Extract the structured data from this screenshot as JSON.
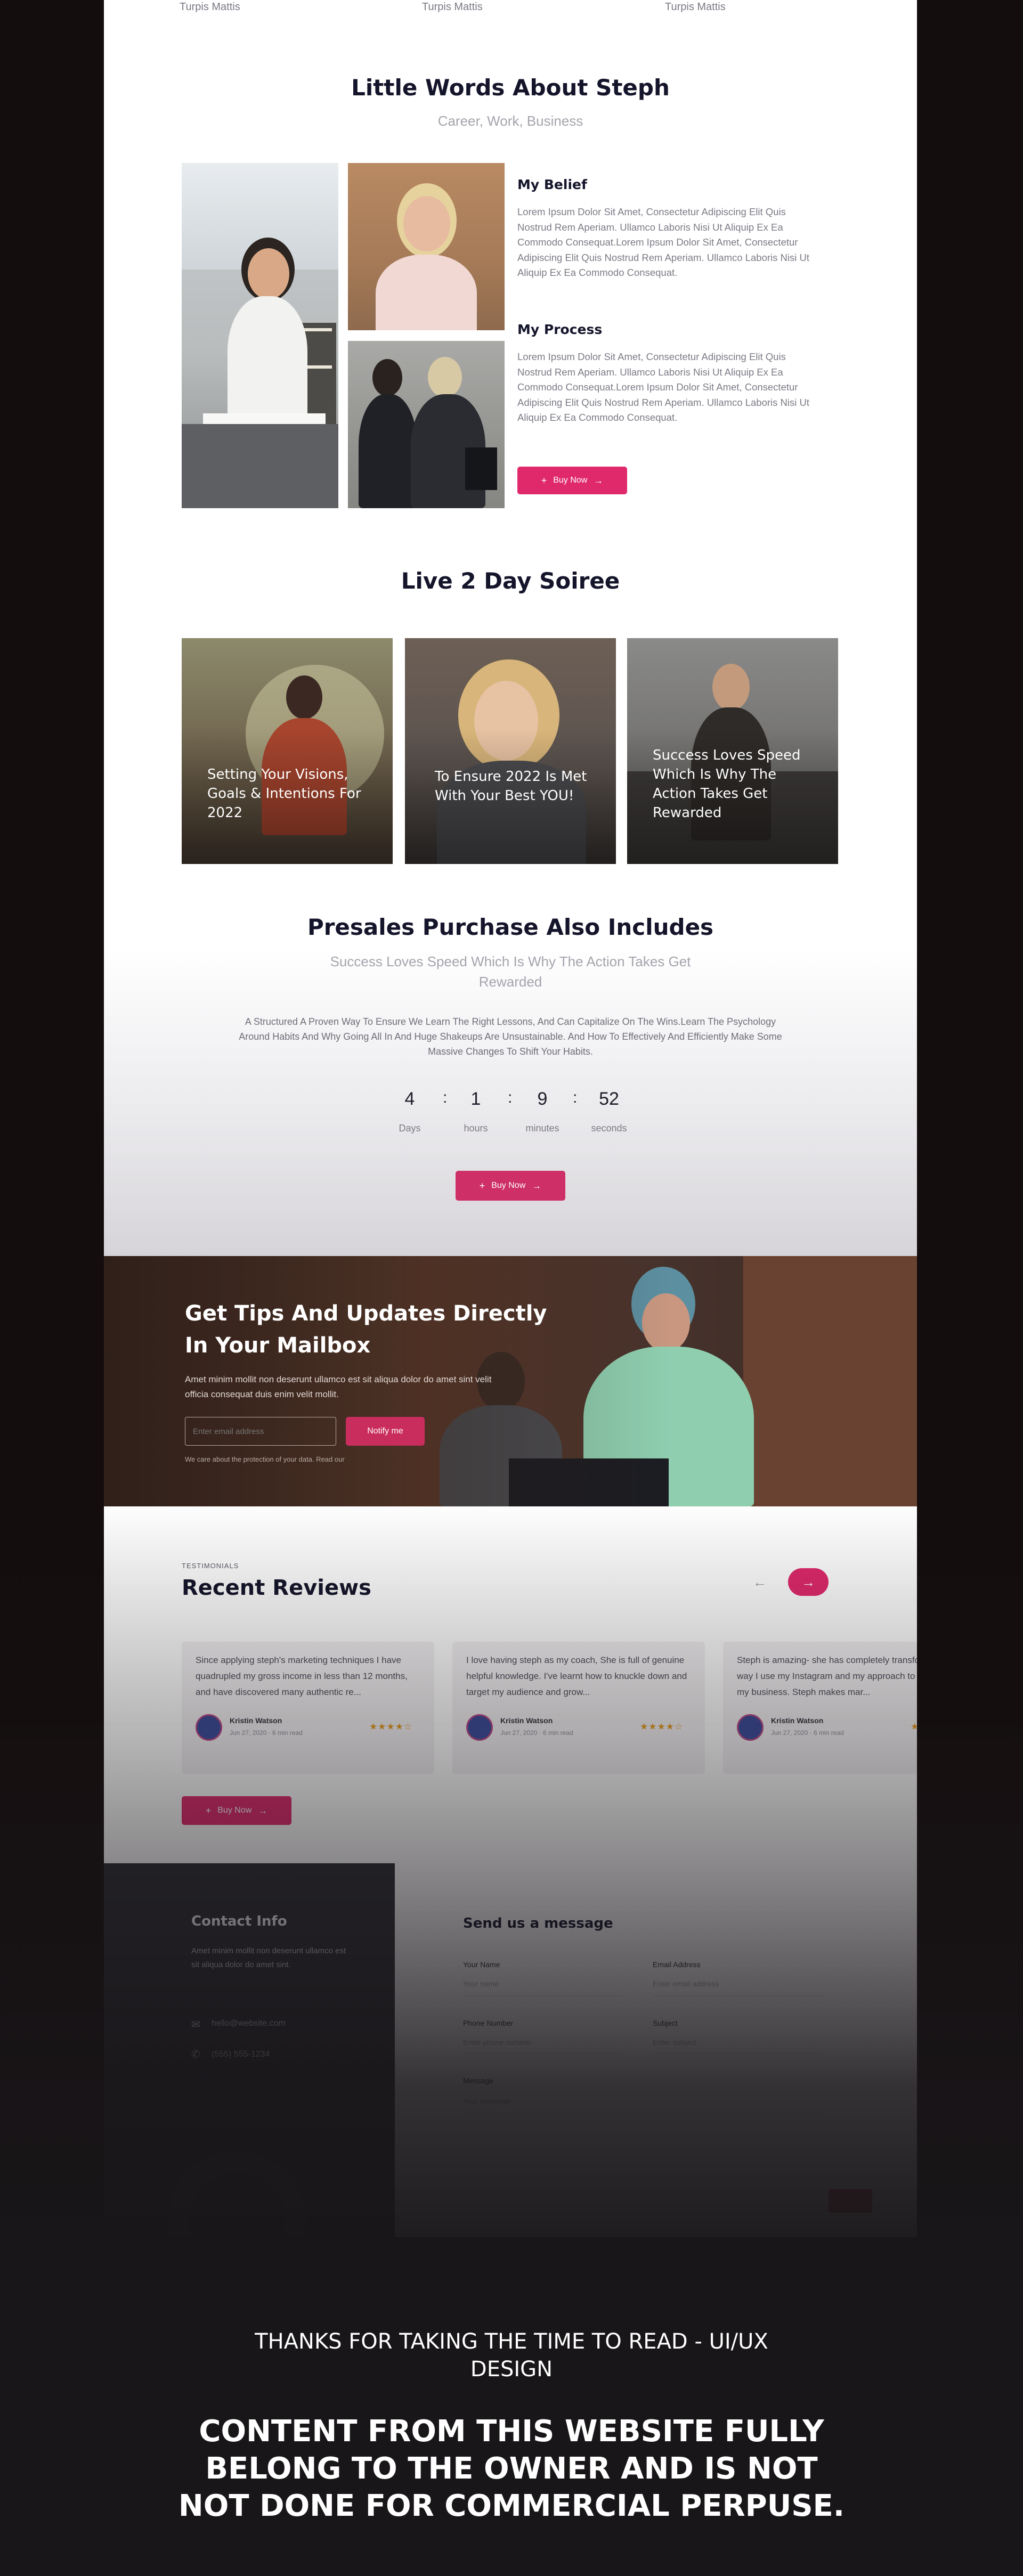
{
  "top_names": [
    "Turpis Mattis",
    "Turpis Mattis",
    "Turpis Mattis"
  ],
  "about": {
    "title": "Little Words About Steph",
    "subtitle": "Career, Work, Business",
    "belief_title": "My Belief",
    "belief_text": "Lorem Ipsum Dolor Sit Amet, Consectetur Adipiscing Elit Quis Nostrud Rem Aperiam. Ullamco Laboris Nisi Ut Aliquip Ex Ea Commodo Consequat.Lorem Ipsum Dolor Sit Amet, Consectetur Adipiscing Elit Quis Nostrud Rem Aperiam. Ullamco Laboris Nisi Ut Aliquip Ex Ea Commodo Consequat.",
    "process_title": "My Process",
    "process_text": "Lorem Ipsum Dolor Sit Amet, Consectetur Adipiscing Elit Quis Nostrud Rem Aperiam. Ullamco Laboris Nisi Ut Aliquip Ex Ea Commodo Consequat.Lorem Ipsum Dolor Sit Amet, Consectetur Adipiscing Elit Quis Nostrud Rem Aperiam. Ullamco Laboris Nisi Ut Aliquip Ex Ea Commodo Consequat.",
    "button": "Buy Now"
  },
  "soiree": {
    "title": "Live 2 Day Soiree",
    "cards": [
      "Setting Your Visions, Goals & Intentions For 2022",
      "To Ensure 2022 Is Met With Your Best YOU!",
      "Success Loves Speed Which Is Why The Action Takes Get Rewarded"
    ]
  },
  "presales": {
    "title": "Presales Purchase Also Includes",
    "subtitle": "Success Loves Speed Which Is Why The Action Takes Get Rewarded",
    "text": "A Structured A Proven Way To Ensure We Learn The Right Lessons, And Can Capitalize On The Wins.Learn The Psychology Around Habits And Why Going All In And Huge Shakeups Are Unsustainable. And How To Effectively And Efficiently Make Some Massive Changes To Shift Your Habits.",
    "countdown": {
      "days": "4",
      "hours": "1",
      "minutes": "9",
      "seconds": "52",
      "days_label": "Days",
      "hours_label": "hours",
      "minutes_label": "minutes",
      "seconds_label": "seconds",
      "sep": ":"
    },
    "button": "Buy Now"
  },
  "newsletter": {
    "title": "Get Tips And Updates Directly In Your Mailbox",
    "text": "Amet minim mollit non deserunt ullamco est sit aliqua dolor do amet sint velit officia consequat duis enim velit mollit.",
    "email_placeholder": "Enter email address",
    "button": "Notify me",
    "note": "We care about the protection of your data. Read our"
  },
  "reviews": {
    "eyebrow": "TESTIMONIALS",
    "title": "Recent Reviews",
    "items": [
      {
        "text": "Since applying steph's marketing techniques I have quadrupled my gross income in less than 12 months, and have discovered many authentic re...",
        "name": "Kristin Watson",
        "date": "Jun 27, 2020 · 6 min read",
        "stars": "★★★★☆"
      },
      {
        "text": "I love having steph as my coach, She is full of genuine helpful knowledge. I've learnt how to knuckle down and target my audience and grow...",
        "name": "Kristin Watson",
        "date": "Jun 27, 2020 · 6 min read",
        "stars": "★★★★☆"
      },
      {
        "text": "Steph is amazing- she has completely transformed the way I use my Instagram and my approach to building my business. Steph makes mar...",
        "name": "Kristin Watson",
        "date": "Jun 27, 2020 · 6 min read",
        "stars": "★★★★☆"
      }
    ],
    "button": "Buy Now"
  },
  "contact": {
    "info_title": "Contact Info",
    "info_text": "Amet minim mollit non deserunt ullamco est sit aliqua dolor do amet sint.",
    "email": "hello@website.com",
    "phone": "(555) 555-1234",
    "form_title": "Send us a message",
    "fields": [
      {
        "label": "Your Name",
        "placeholder": "Your name"
      },
      {
        "label": "Email Address",
        "placeholder": "Enter email address"
      },
      {
        "label": "Phone Number",
        "placeholder": "Enter phone number"
      },
      {
        "label": "Subject",
        "placeholder": "Enter subject"
      },
      {
        "label": "Message",
        "placeholder": "Your message"
      }
    ]
  },
  "footer": {
    "thanks": "THANKS FOR TAKING THE TIME TO READ - UI/UX DESIGN",
    "disclaimer": "CONTENT FROM THIS WEBSITE FULLY BELONG TO THE OWNER AND IS NOT NOT DONE FOR COMMERCIAL PERPUSE."
  },
  "colors": {
    "accent": "#e0296b",
    "heading": "#14142b",
    "page_bg": "#140d0d"
  }
}
